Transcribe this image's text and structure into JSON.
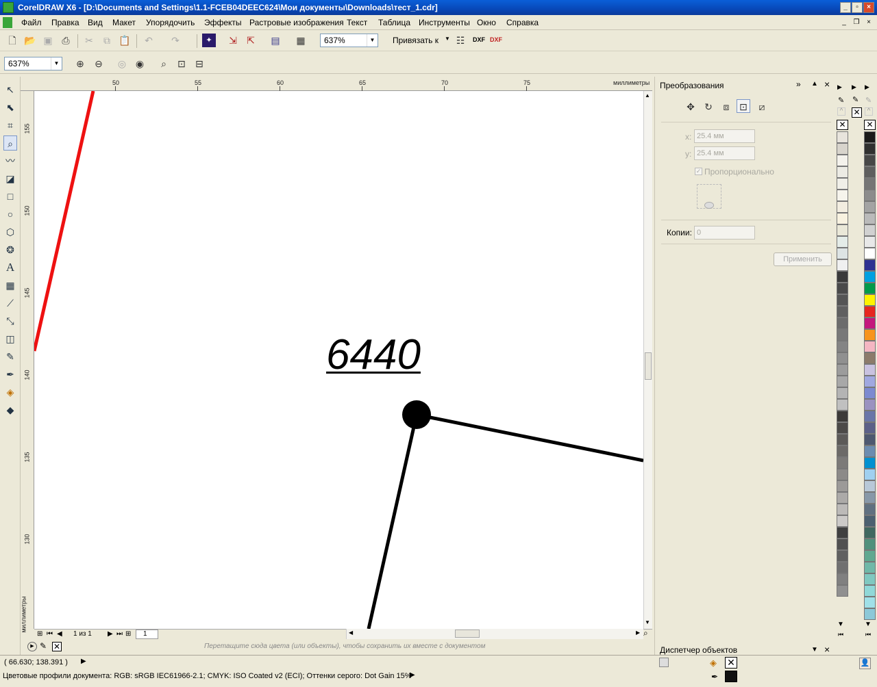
{
  "window": {
    "title": "CorelDRAW X6 - [D:\\Documents and Settings\\1.1-FCEB04DEEC624\\Мои документы\\Downloads\\тест_1.cdr]"
  },
  "menu": [
    "Файл",
    "Правка",
    "Вид",
    "Макет",
    "Упорядочить",
    "Эффекты",
    "Растровые изображения",
    "Текст",
    "Таблица",
    "Инструменты",
    "Окно",
    "Справка"
  ],
  "toolbar": {
    "zoom_value": "637%",
    "snap_label": "Привязать к",
    "dxf1": "DXF",
    "dxf2": "DXF"
  },
  "toolbar2": {
    "zoom_value": "637%"
  },
  "ruler": {
    "unit": "миллиметры",
    "top_labels": [
      "50",
      "55",
      "60",
      "65",
      "70",
      "75"
    ],
    "left_labels": [
      "155",
      "150",
      "145",
      "140",
      "135",
      "130"
    ]
  },
  "canvas": {
    "text": "6440"
  },
  "pagebar": {
    "page_of": "1 из 1",
    "tab": "1"
  },
  "colordrop": {
    "hint": "Перетащите сюда цвета (или объекты), чтобы сохранить их вместе с документом"
  },
  "docker": {
    "title": "Преобразования",
    "x_label": "x:",
    "x_value": "25.4 мм",
    "y_label": "y:",
    "y_value": "25.4 мм",
    "proportional": "Пропорционально",
    "copies_label": "Копии:",
    "copies_value": "0",
    "apply": "Применить",
    "object_manager": "Диспетчер объектов"
  },
  "status": {
    "coords": "( 66.630; 138.391 )",
    "color_profiles": "Цветовые профили документа: RGB: sRGB IEC61966-2.1; CMYK: ISO Coated v2 (ECI); Оттенки серого: Dot Gain 15%"
  },
  "palette1": [
    "#e8e4dc",
    "#d8d4cc",
    "#f4f2ec",
    "#ecebe4",
    "#f0efe8",
    "#f6f4ec",
    "#f2ede0",
    "#f8f2e0",
    "#eae8d8",
    "#e4ece8",
    "#dde4e4",
    "#f0f0f0",
    "#3a3a3a",
    "#4a4a4a",
    "#555555",
    "#606060",
    "#6c6c6c",
    "#787878",
    "#848484",
    "#909090",
    "#9c9c9c",
    "#a8a8a8",
    "#b4b4b4",
    "#c0c0c0",
    "#3c3a38",
    "#4c4a48",
    "#5c5a58",
    "#6c6a68",
    "#7c7a78",
    "#8c8a88",
    "#9c9a98",
    "#acaaa8",
    "#bcbab8",
    "#cccac8",
    "#404040",
    "#505050",
    "#606060",
    "#707070",
    "#808080",
    "#909090"
  ],
  "palette2": [
    "#1a1a1a",
    "#303030",
    "#474747",
    "#5e5e5e",
    "#757575",
    "#8c8c8c",
    "#a3a3a3",
    "#bababa",
    "#d1d1d1",
    "#e8e8e8",
    "#ffffff",
    "#2e3192",
    "#00a0e0",
    "#009a4a",
    "#fff200",
    "#e6261f",
    "#c4177c",
    "#f7941d",
    "#f4b6c2",
    "#8c7b6b",
    "#c9c2e0",
    "#a0a8e0",
    "#7c8ad0",
    "#9a92c0",
    "#6a76a8",
    "#5c6088",
    "#4e5870",
    "#6c8cb0",
    "#0090d0",
    "#a0d0f0",
    "#b8c8d8",
    "#8898a8",
    "#607080",
    "#4c6070",
    "#406860",
    "#50907c",
    "#60a890",
    "#70b8a8",
    "#80c8c0",
    "#90d8d8",
    "#a0e0e8",
    "#8cc8d8"
  ]
}
